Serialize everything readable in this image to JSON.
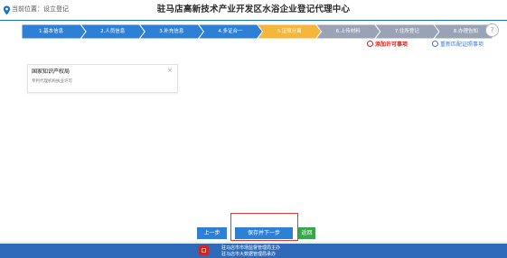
{
  "header": {
    "location_label": "当前位置：设立登记",
    "title": "驻马店高新技术产业开发区水浴企业登记代理中心"
  },
  "steps": [
    {
      "label": "1.基本信息",
      "state": "done"
    },
    {
      "label": "2.人员信息",
      "state": "done"
    },
    {
      "label": "3.补充信息",
      "state": "done"
    },
    {
      "label": "4.多证合一",
      "state": "done"
    },
    {
      "label": "5.证照分离",
      "state": "active"
    },
    {
      "label": "6.上传材料",
      "state": "todo"
    },
    {
      "label": "7.住所登记",
      "state": "todo"
    },
    {
      "label": "8.办理告知",
      "state": "todo"
    }
  ],
  "step_help_icon": "question-circle-icon",
  "actions": {
    "add_permit": "添加许可事项",
    "refresh_permit": "重新匹配证照事项"
  },
  "card": {
    "title": "国家知识产权局",
    "subtitle": "专利代理机构执业许可",
    "close": "×"
  },
  "buttons": {
    "prev": "上一步",
    "save_next": "保存并下一步",
    "back": "返回"
  },
  "footer": {
    "line1": "驻马店市市场监督管理局主办",
    "line2": "驻马店市大数据管理局承办"
  },
  "colors": {
    "accent": "#2e7fd6",
    "step_done": "#2e7fd6",
    "step_active": "#f5b73b",
    "step_todo": "#9aa3b5",
    "highlight": "#e53935",
    "footer": "#2e6ab8"
  }
}
